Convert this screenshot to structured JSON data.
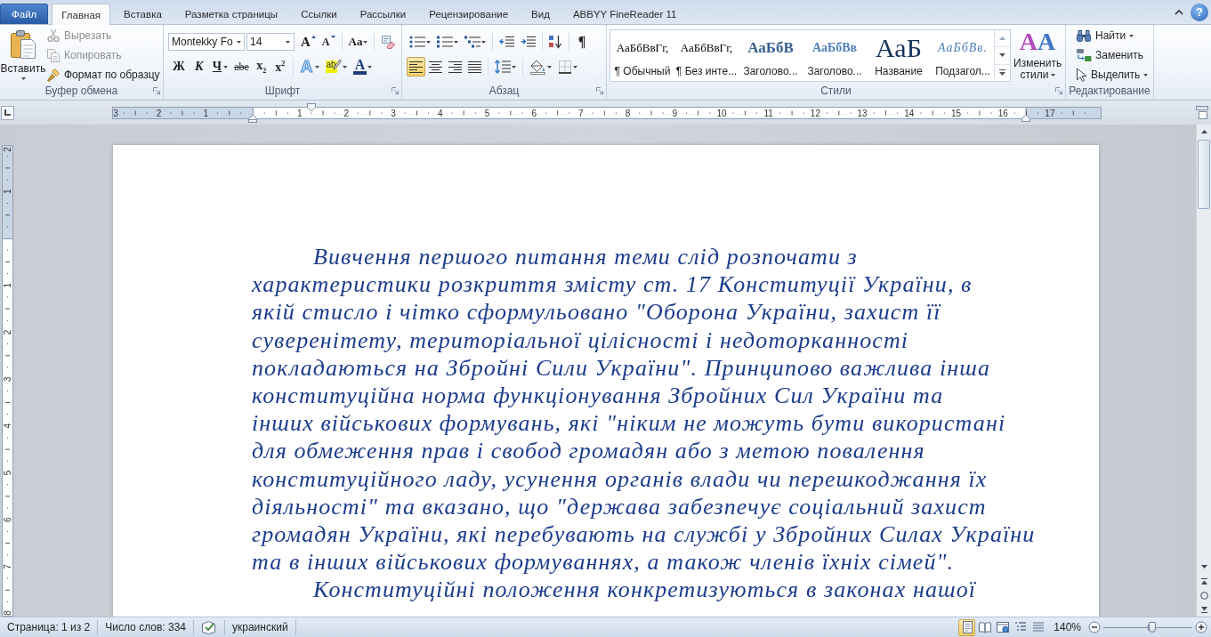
{
  "tabs": [
    {
      "label": "Файл",
      "kind": "file",
      "selected": false
    },
    {
      "label": "Главная",
      "kind": "tab",
      "selected": true
    },
    {
      "label": "Вставка",
      "kind": "tab",
      "selected": false
    },
    {
      "label": "Разметка страницы",
      "kind": "tab",
      "selected": false
    },
    {
      "label": "Ссылки",
      "kind": "tab",
      "selected": false
    },
    {
      "label": "Рассылки",
      "kind": "tab",
      "selected": false
    },
    {
      "label": "Рецензирование",
      "kind": "tab",
      "selected": false
    },
    {
      "label": "Вид",
      "kind": "tab",
      "selected": false
    },
    {
      "label": "ABBYY FineReader 11",
      "kind": "tab",
      "selected": false
    }
  ],
  "help_button": "?",
  "ribbon": {
    "clipboard": {
      "label": "Буфер обмена",
      "paste": "Вставить",
      "items": [
        {
          "label": "Вырезать",
          "kind": "cut",
          "disabled": true
        },
        {
          "label": "Копировать",
          "kind": "copy",
          "disabled": true
        },
        {
          "label": "Формат по образцу",
          "kind": "format_painter",
          "disabled": false
        }
      ]
    },
    "font": {
      "label": "Шрифт",
      "rows": [
        {
          "clusters": [
            {
              "items": [
                {
                  "kind": "font_name",
                  "value": "Montekky Fo"
                },
                {
                  "kind": "font_size",
                  "value": "14"
                },
                {
                  "kind": "grow",
                  "text": "A"
                },
                {
                  "kind": "shrink",
                  "text": "A"
                }
              ]
            },
            {
              "items": [
                {
                  "kind": "change_case",
                  "text": "Aa",
                  "menu": true
                }
              ]
            },
            {
              "items": [
                {
                  "kind": "clear_formatting"
                }
              ]
            }
          ]
        },
        {
          "clusters": [
            {
              "items": [
                {
                  "kind": "bold",
                  "text": "Ж"
                },
                {
                  "kind": "italic",
                  "text": "К"
                },
                {
                  "kind": "underline",
                  "text": "Ч",
                  "menu": true
                },
                {
                  "kind": "strikethrough",
                  "text": "abe"
                },
                {
                  "kind": "subscript",
                  "text": "x$_{2}$"
                },
                {
                  "kind": "superscript",
                  "text": "x$^{2}$"
                }
              ]
            },
            {
              "items": [
                {
                  "kind": "text_effects",
                  "text": "A",
                  "menu": true
                },
                {
                  "kind": "highlight",
                  "text": "ab",
                  "menu": true
                },
                {
                  "kind": "font_color",
                  "text": "A",
                  "menu": true
                }
              ]
            }
          ]
        }
      ]
    },
    "paragraph": {
      "label": "Абзац",
      "rows": [
        {
          "clusters": [
            {
              "items": [
                {
                  "kind": "bullets",
                  "menu": true
                },
                {
                  "kind": "numbering",
                  "menu": true
                },
                {
                  "kind": "multilevel",
                  "menu": true
                }
              ]
            },
            {
              "items": [
                {
                  "kind": "outdent"
                },
                {
                  "kind": "indent"
                }
              ]
            },
            {
              "items": [
                {
                  "kind": "sort"
                }
              ]
            },
            {
              "items": [
                {
                  "kind": "show_marks",
                  "text": "¶"
                }
              ]
            }
          ]
        },
        {
          "clusters": [
            {
              "items": [
                {
                  "kind": "align_left",
                  "selected": true
                },
                {
                  "kind": "align_center",
                  "selected": false
                },
                {
                  "kind": "align_right",
                  "selected": false
                },
                {
                  "kind": "justify",
                  "selected": false
                }
              ]
            },
            {
              "items": [
                {
                  "kind": "line_spacing",
                  "menu": true
                }
              ]
            },
            {
              "items": [
                {
                  "kind": "shading",
                  "menu": true
                },
                {
                  "kind": "borders",
                  "menu": true
                }
              ]
            }
          ]
        }
      ]
    },
    "styles": {
      "label": "Стили",
      "gallery": [
        {
          "kind": "normal",
          "preview": "АаБбВвГг,",
          "name": "¶ Обычный"
        },
        {
          "kind": "no_spacing",
          "preview": "АаБбВвГг,",
          "name": "¶ Без инте..."
        },
        {
          "kind": "heading1",
          "preview": "АаБбВ",
          "name": "Заголово..."
        },
        {
          "kind": "heading2",
          "preview": "АаБбВв",
          "name": "Заголово..."
        },
        {
          "kind": "title",
          "preview": "АаБ",
          "name": "Название"
        },
        {
          "kind": "subtitle",
          "preview": "АаБбВв.",
          "name": "Подзагол..."
        }
      ],
      "change_styles": {
        "glyph": "AA",
        "label": "Изменить стили"
      }
    },
    "editing": {
      "label": "Редактирование",
      "items": [
        {
          "kind": "find",
          "label": "Найти",
          "menu": true
        },
        {
          "kind": "replace",
          "label": "Заменить",
          "menu": false
        },
        {
          "kind": "select",
          "label": "Выделить",
          "menu": true
        }
      ]
    }
  },
  "ruler": {
    "left_numbers": [
      "3",
      "2",
      "1"
    ],
    "numbers": [
      "1",
      "2",
      "3",
      "4",
      "5",
      "6",
      "7",
      "8",
      "9",
      "10",
      "11",
      "12",
      "13",
      "14",
      "15",
      "16",
      "17"
    ]
  },
  "vertical_ruler": {
    "top_numbers": [
      "2",
      "1"
    ],
    "numbers": [
      "1",
      "2",
      "3",
      "4",
      "5",
      "6",
      "7",
      "8"
    ]
  },
  "document": {
    "paragraphs": [
      {
        "lines": [
          "Вивчення першого питання теми слід розпочати з",
          "характеристики розкриття змісту ст. 17 Конституції України, в",
          "якій стисло і чітко сформульовано \"Оборона України, захист її",
          "суверенітету, територіальної цілісності і недоторканності",
          "покладаються на Збройні Сили України\". Принципово важлива інша",
          "конституційна норма функціонування Збройних Сил України та",
          "інших військових формувань, які \"ніким не можуть бути використані",
          "для обмеження прав і свобод громадян або з метою повалення",
          "конституційного ладу, усунення органів влади чи перешкоджання їх",
          "діяльності\" та вказано, що \"держава забезпечує соціальний захист",
          "громадян України, які перебувають на службі у Збройних Силах України",
          "та в інших військових формуваннях, а також членів їхніх сімей\"."
        ]
      },
      {
        "lines": [
          "Конституційні положення конкретизуються в законах нашої"
        ]
      }
    ]
  },
  "status_bar": {
    "items": [
      {
        "kind": "text",
        "label": "Страница: 1 из 2"
      },
      {
        "kind": "text",
        "label": "Число слов: 334"
      },
      {
        "kind": "proofing"
      },
      {
        "kind": "text",
        "label": "украинский"
      }
    ],
    "views": [
      {
        "kind": "print_layout",
        "selected": true
      },
      {
        "kind": "full_reading",
        "selected": false
      },
      {
        "kind": "web_layout",
        "selected": false
      },
      {
        "kind": "outline",
        "selected": false
      },
      {
        "kind": "draft",
        "selected": false
      }
    ],
    "zoom": {
      "label": "140%",
      "level": 0.55
    }
  }
}
